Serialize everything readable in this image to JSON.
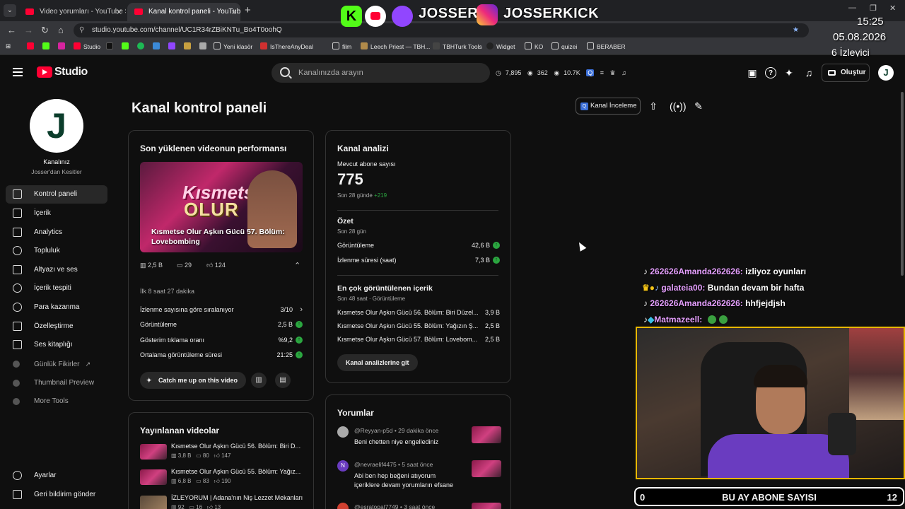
{
  "browser": {
    "tabs": [
      {
        "label": "Video yorumları - YouTube Stud"
      },
      {
        "label": "Kanal kontrol paneli - YouTube"
      }
    ],
    "url": "studio.youtube.com/channel/UC1R34rZBiKNTu_Bo4T0oohQ",
    "bookmarks": [
      "Studio",
      "Yeni klasör",
      "IsThereAnyDeal",
      "film",
      "Leech Priest — TBH...",
      "TBHTurk Tools",
      "Widget",
      "KO",
      "quizei",
      "BERABER"
    ]
  },
  "overlay": {
    "handle1": "JOSSER",
    "handle2": "JOSSERKICK",
    "time": "15:25",
    "date": "05.08.2026",
    "viewers": "6 İzleyici",
    "chat": [
      {
        "user": "262626Amanda262626:",
        "msg": "izliyoz oyunları"
      },
      {
        "user": "galateia00:",
        "msg": "Bundan devam bir hafta"
      },
      {
        "user": "262626Amanda262626:",
        "msg": "hhfjejdjsh"
      },
      {
        "user": "Matmazeell:",
        "msg": ""
      }
    ],
    "sub_bar": {
      "left": "0",
      "label": "BU AY ABONE SAYISI",
      "right": "12"
    }
  },
  "header": {
    "logo": "Studio",
    "search_placeholder": "Kanalınızda arayın",
    "stats": [
      "7,895",
      "362",
      "10.7K"
    ],
    "create_label": "Oluştur",
    "avatar_letter": "J"
  },
  "sidebar": {
    "avatar_letter": "J",
    "channel_title": "Kanalınız",
    "channel_name": "Josser'dan Kesitler",
    "items": [
      {
        "label": "Kontrol paneli"
      },
      {
        "label": "İçerik"
      },
      {
        "label": "Analytics"
      },
      {
        "label": "Topluluk"
      },
      {
        "label": "Altyazı ve ses"
      },
      {
        "label": "İçerik tespiti"
      },
      {
        "label": "Para kazanma"
      },
      {
        "label": "Özelleştirme"
      },
      {
        "label": "Ses kitaplığı"
      },
      {
        "label": "Günlük Fikirler"
      },
      {
        "label": "Thumbnail Preview"
      },
      {
        "label": "More Tools"
      }
    ],
    "settings": "Ayarlar",
    "feedback": "Geri bildirim gönder"
  },
  "main": {
    "title": "Kanal kontrol paneli",
    "kanal_btn": "Kanal İnceleme",
    "perf": {
      "title": "Son yüklenen videonun performansı",
      "thumb_caption": "Kısmetse Olur Aşkın Gücü 57. Bölüm: Lovebombing",
      "thumb_logo1": "Kısmetse",
      "thumb_logo2": "OLUR",
      "views": "2,5 B",
      "comments": "29",
      "likes": "124",
      "since": "İlk 8 saat 27 dakika",
      "rows": [
        {
          "label": "İzlenme sayısına göre sıralanıyor",
          "value": "3/10"
        },
        {
          "label": "Görüntüleme",
          "value": "2,5 B"
        },
        {
          "label": "Gösterim tıklama oranı",
          "value": "%9,2"
        },
        {
          "label": "Ortalama görüntüleme süresi",
          "value": "21:25"
        }
      ],
      "catch_btn": "Catch me up on this video"
    },
    "analytics": {
      "title": "Kanal analizi",
      "subs_label": "Mevcut abone sayısı",
      "subs": "775",
      "subs_delta_label": "Son 28 günde",
      "subs_delta": "+219",
      "summary_title": "Özet",
      "summary_sub": "Son 28 gün",
      "summary": [
        {
          "label": "Görüntüleme",
          "value": "42,6 B"
        },
        {
          "label": "İzlenme süresi (saat)",
          "value": "7,3 B"
        }
      ],
      "top_title": "En çok görüntülenen içerik",
      "top_sub": "Son 48 saat · Görüntüleme",
      "top": [
        {
          "label": "Kısmetse Olur Aşkın Gücü 56. Bölüm: Biri Düzel...",
          "value": "3,9 B"
        },
        {
          "label": "Kısmetse Olur Aşkın Gücü 55. Bölüm: Yağızın Ş...",
          "value": "2,5 B"
        },
        {
          "label": "Kısmetse Olur Aşkın Gücü 57. Bölüm: Lovebom...",
          "value": "2,5 B"
        }
      ],
      "btn": "Kanal analizlerine git"
    },
    "published": {
      "title": "Yayınlanan videolar",
      "items": [
        {
          "title": "Kısmetse Olur Aşkın Gücü 56. Bölüm: Biri D...",
          "views": "3,8 B",
          "comments": "80",
          "likes": "147"
        },
        {
          "title": "Kısmetse Olur Aşkın Gücü 55. Bölüm: Yağız...",
          "views": "6,8 B",
          "comments": "83",
          "likes": "190"
        },
        {
          "title": "İZLEYORUM | Adana'nın Niş Lezzet Mekanları",
          "views": "92",
          "comments": "16",
          "likes": "13"
        }
      ]
    },
    "comments": {
      "title": "Yorumlar",
      "items": [
        {
          "avatar": "",
          "user": "@Reyyan-p5d",
          "time": "• 29 dakika önce",
          "text": "Beni chetten niye engellediniz"
        },
        {
          "avatar": "N",
          "user": "@nevraelif4475",
          "time": "• 5 saat önce",
          "text": "Abi ben hep beğeni atıyorum içeriklere devam yorumların efsane"
        },
        {
          "avatar": "",
          "user": "@esratopal7749",
          "time": "• 3 saat önce",
          "text": ""
        }
      ]
    }
  }
}
